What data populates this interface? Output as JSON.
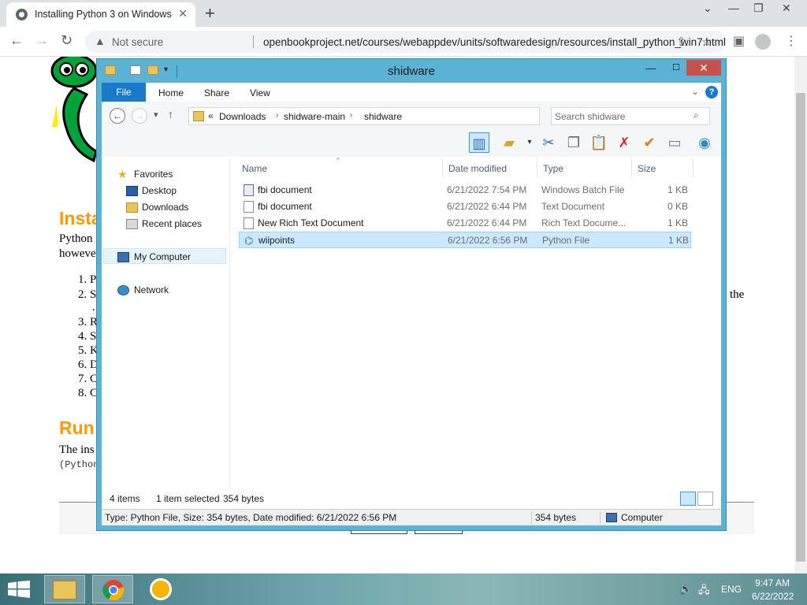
{
  "browser": {
    "tab_title": "Installing Python 3 on Windows",
    "not_secure": "Not secure",
    "url": "openbookproject.net/courses/webappdev/units/softwaredesign/resources/install_python_win7.html"
  },
  "page": {
    "heading1": "Insta",
    "para1_line1": "Python",
    "para1_line2": "howeve",
    "list_items": [
      "1. P",
      "2. S",
      ".",
      "3. R",
      "4. S",
      "5. K",
      "6. D",
      "7. C",
      "8. C"
    ],
    "right_text": "the",
    "heading2": "Run",
    "para2": "The ins",
    "mono": "(Python"
  },
  "explorer": {
    "title": "shidware",
    "ribbon_tabs": [
      "File",
      "Home",
      "Share",
      "View"
    ],
    "breadcrumb_prefix": "«",
    "breadcrumbs": [
      "Downloads",
      "shidware-main",
      "shidware"
    ],
    "search_placeholder": "Search shidware",
    "nav": {
      "favorites": "Favorites",
      "desktop": "Desktop",
      "downloads": "Downloads",
      "recent": "Recent places",
      "computer": "My Computer",
      "network": "Network"
    },
    "columns": [
      "Name",
      "Date modified",
      "Type",
      "Size"
    ],
    "files": [
      {
        "name": "fbi document",
        "date": "6/21/2022 7:54 PM",
        "type": "Windows Batch File",
        "size": "1 KB"
      },
      {
        "name": "fbi document",
        "date": "6/21/2022 6:44 PM",
        "type": "Text Document",
        "size": "0 KB"
      },
      {
        "name": "New Rich Text Document",
        "date": "6/21/2022 6:44 PM",
        "type": "Rich Text Docume...",
        "size": "1 KB"
      },
      {
        "name": "wiipoints",
        "date": "6/21/2022 6:56 PM",
        "type": "Python File",
        "size": "1 KB"
      }
    ],
    "status": {
      "items": "4 items",
      "selected": "1 item selected",
      "bytes": "354 bytes"
    },
    "details": {
      "info": "Type: Python File, Size: 354 bytes, Date modified: 6/21/2022 6:56 PM",
      "size": "354 bytes",
      "location": "Computer"
    }
  },
  "taskbar": {
    "lang": "ENG",
    "time": "9:47 AM",
    "date": "6/22/2022"
  },
  "colors": {
    "window_frame": "#5ab2d4",
    "file_tab": "#1979ca",
    "selection": "#cce8ff",
    "heading_orange": "#ff9900",
    "close_red": "#c7504a"
  }
}
